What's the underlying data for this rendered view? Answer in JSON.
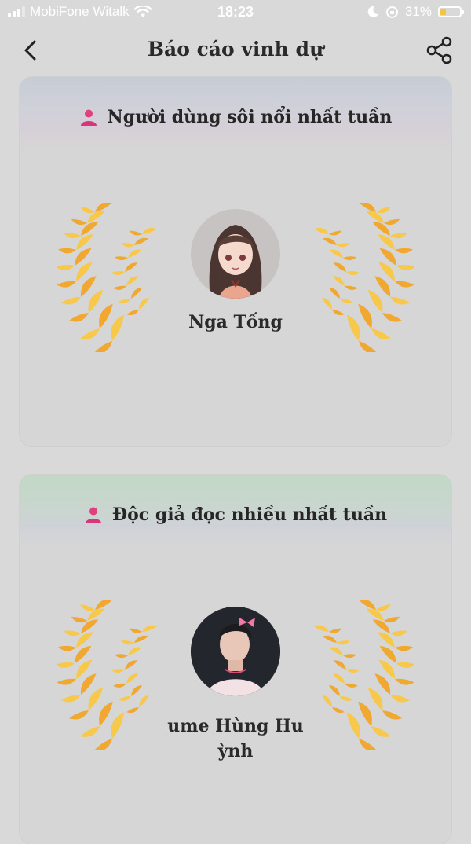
{
  "status_bar": {
    "carrier": "MobiFone Witalk",
    "time": "18:23",
    "battery": "31%",
    "battery_level": 0.31,
    "icons": [
      "signal-icon",
      "wifi-icon",
      "moon-icon",
      "orientation-lock-icon",
      "battery-icon"
    ]
  },
  "header": {
    "title": "Báo cáo vinh dự",
    "back_icon": "chevron-left-icon",
    "share_icon": "share-icon"
  },
  "cards": [
    {
      "label": "Người dùng sôi nổi nhất tuần",
      "icon": "person-icon",
      "user_name": "Nga Tống",
      "accent": "#c6ccd6"
    },
    {
      "label": "Độc giả đọc nhiều nhất tuần",
      "icon": "person-icon",
      "user_name": "ume Hùng Hu ỳnh",
      "accent": "#c2d8c6"
    }
  ],
  "colors": {
    "laurel_gold": "#f0a830",
    "laurel_light": "#f7c84a",
    "person_pink": "#e0407e"
  }
}
